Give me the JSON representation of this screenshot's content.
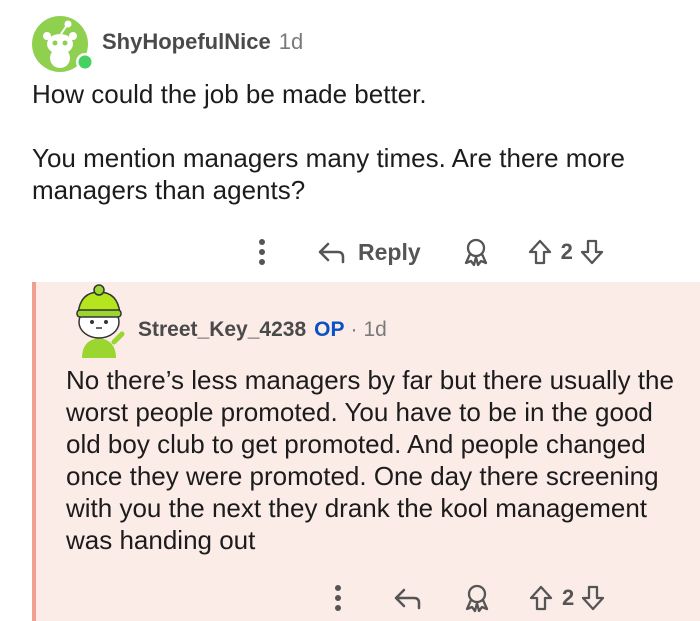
{
  "comment": {
    "username": "ShyHopefulNice",
    "age": "1d",
    "paragraphs": [
      "How could the job be made better.",
      "You mention managers many times. Are there more managers than agents?"
    ],
    "actions": {
      "reply_label": "Reply",
      "vote_count": "2"
    }
  },
  "reply": {
    "username": "Street_Key_4238",
    "op_badge": "OP",
    "separator": "·",
    "age": "1d",
    "text": "No there’s less managers by far but there usually the worst people promoted. You have to be in the good old boy club to get promoted. And people changed once they were promoted. One day there screening with you the next they drank the kool management was handing out",
    "actions": {
      "vote_count": "2"
    }
  },
  "colors": {
    "reply_background": "#fcece8",
    "thread_line": "#f0a090",
    "op_badge": "#0a52c4",
    "online_dot": "#46d160",
    "avatar1_bg": "#8fd14f"
  }
}
